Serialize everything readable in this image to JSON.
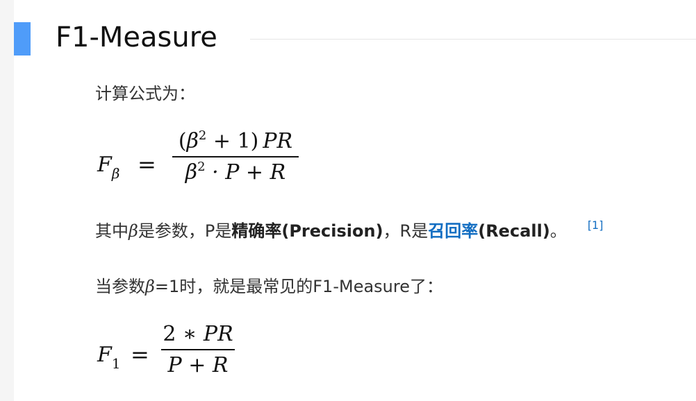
{
  "heading": {
    "title": "F1-Measure"
  },
  "intro": "计算公式为：",
  "formula1": {
    "lhs_base": "F",
    "lhs_sub": "β",
    "equals": "=",
    "num_open": "(",
    "num_beta": "β",
    "num_exp": "2",
    "num_plus_one": " + 1",
    "num_close": ")",
    "num_pr": "PR",
    "den_beta": "β",
    "den_exp": "2",
    "den_rest": " · P + R"
  },
  "sentence1": {
    "prefix": "其中",
    "beta": "β",
    "mid1": "是参数，P是",
    "precision": "精确率(Precision)",
    "mid2": "，R是",
    "recall_link": "召回率",
    "recall_paren": "(Recall)",
    "end": "。",
    "ref": "[1]"
  },
  "sentence2": {
    "prefix": "当参数",
    "beta": "β",
    "rest": "=1时，就是最常见的F1-Measure了："
  },
  "formula2": {
    "lhs_base": "F",
    "lhs_sub": "1",
    "equals": "=",
    "num_two": "2",
    "num_star": " ∗ ",
    "num_pr": "PR",
    "den": "P + R"
  }
}
